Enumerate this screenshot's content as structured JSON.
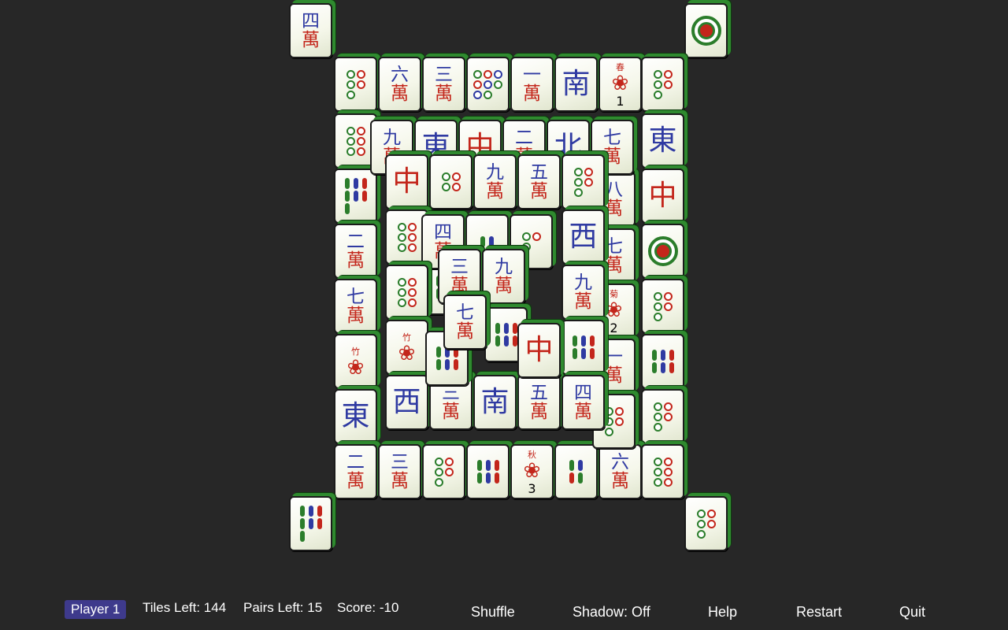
{
  "status": {
    "player": "Player 1",
    "tiles_left": "Tiles Left: 144",
    "pairs_left": "Pairs Left: 15",
    "score": "Score: -10"
  },
  "menu": {
    "shuffle": "Shuffle",
    "shadow": "Shadow: Off",
    "help": "Help",
    "restart": "Restart",
    "quit": "Quit"
  },
  "colors": {
    "background": "#272727",
    "tile_side": "#2f8a2f",
    "player_badge": "#3e3a8c",
    "char_blue": "#2f3aa2",
    "char_red": "#c3261b",
    "bamboo_green": "#2b7d2b"
  },
  "tiles": [
    {
      "kind": "char",
      "top": "四",
      "bot": "萬"
    },
    {
      "kind": "dragon-white"
    },
    {
      "kind": "dots",
      "n": 5
    },
    {
      "kind": "char",
      "top": "六",
      "bot": "萬"
    },
    {
      "kind": "char",
      "top": "三",
      "bot": "萬"
    },
    {
      "kind": "dots",
      "n": 8
    },
    {
      "kind": "char",
      "top": "一",
      "bot": "萬"
    },
    {
      "kind": "honor",
      "top": "南",
      "color": "blue"
    },
    {
      "kind": "flower",
      "name": "春",
      "num": "1"
    },
    {
      "kind": "dots",
      "n": 5
    },
    {
      "kind": "dots",
      "n": 6
    },
    {
      "kind": "honor",
      "top": "東",
      "color": "blue"
    },
    {
      "kind": "bam",
      "n": 7
    },
    {
      "kind": "honor",
      "top": "中",
      "color": "red"
    },
    {
      "kind": "char",
      "top": "二",
      "bot": "萬"
    },
    {
      "kind": "dragon-white"
    },
    {
      "kind": "char",
      "top": "七",
      "bot": "萬"
    },
    {
      "kind": "dots",
      "n": 5
    },
    {
      "kind": "flower",
      "name": "竹",
      "num": ""
    },
    {
      "kind": "bam",
      "n": 6
    },
    {
      "kind": "honor",
      "top": "東",
      "color": "blue"
    },
    {
      "kind": "dots",
      "n": 5
    },
    {
      "kind": "char",
      "top": "二",
      "bot": "萬"
    },
    {
      "kind": "char",
      "top": "三",
      "bot": "萬"
    },
    {
      "kind": "dots",
      "n": 5
    },
    {
      "kind": "bam",
      "n": 6
    },
    {
      "kind": "flower",
      "name": "秋",
      "num": "3"
    },
    {
      "kind": "bam",
      "n": 4
    },
    {
      "kind": "char",
      "top": "六",
      "bot": "萬"
    },
    {
      "kind": "dots",
      "n": 6
    },
    {
      "kind": "bam",
      "n": 7
    },
    {
      "kind": "dots",
      "n": 5
    },
    {
      "kind": "char",
      "top": "九",
      "bot": "萬"
    },
    {
      "kind": "honor",
      "top": "東",
      "color": "blue"
    },
    {
      "kind": "honor",
      "top": "中",
      "color": "red"
    },
    {
      "kind": "char",
      "top": "二",
      "bot": "萬"
    },
    {
      "kind": "honor",
      "top": "北",
      "color": "blue"
    },
    {
      "kind": "char",
      "top": "七",
      "bot": "萬"
    },
    {
      "kind": "honor",
      "top": "中",
      "color": "red"
    },
    {
      "kind": "dots",
      "n": 4
    },
    {
      "kind": "char",
      "top": "九",
      "bot": "萬"
    },
    {
      "kind": "char",
      "top": "五",
      "bot": "萬"
    },
    {
      "kind": "dots",
      "n": 5
    },
    {
      "kind": "dots",
      "n": 6
    },
    {
      "kind": "char",
      "top": "四",
      "bot": "萬"
    },
    {
      "kind": "bam",
      "n": 2
    },
    {
      "kind": "dots",
      "n": 3
    },
    {
      "kind": "honor",
      "top": "西",
      "color": "blue"
    },
    {
      "kind": "dots",
      "n": 6
    },
    {
      "kind": "char",
      "top": "九",
      "bot": "萬"
    },
    {
      "kind": "flower",
      "name": "竹",
      "num": ""
    },
    {
      "kind": "bam",
      "n": 6
    },
    {
      "kind": "honor",
      "top": "西",
      "color": "blue"
    },
    {
      "kind": "char",
      "top": "三",
      "bot": "萬"
    },
    {
      "kind": "honor",
      "top": "南",
      "color": "blue"
    },
    {
      "kind": "char",
      "top": "五",
      "bot": "萬"
    },
    {
      "kind": "char",
      "top": "四",
      "bot": "萬"
    },
    {
      "kind": "char",
      "top": "三",
      "bot": "萬"
    },
    {
      "kind": "char",
      "top": "九",
      "bot": "萬"
    },
    {
      "kind": "char",
      "top": "七",
      "bot": "萬"
    },
    {
      "kind": "bam",
      "n": 6
    },
    {
      "kind": "honor",
      "top": "中",
      "color": "red"
    },
    {
      "kind": "bam",
      "n": 6
    },
    {
      "kind": "char",
      "top": "八",
      "bot": "萬"
    },
    {
      "kind": "char",
      "top": "七",
      "bot": "萬"
    },
    {
      "kind": "flower",
      "name": "菊",
      "num": "2"
    },
    {
      "kind": "char",
      "top": "一",
      "bot": "萬"
    },
    {
      "kind": "dots",
      "n": 5
    },
    {
      "kind": "bam",
      "n": 6
    },
    {
      "kind": "dots",
      "n": 5
    }
  ]
}
